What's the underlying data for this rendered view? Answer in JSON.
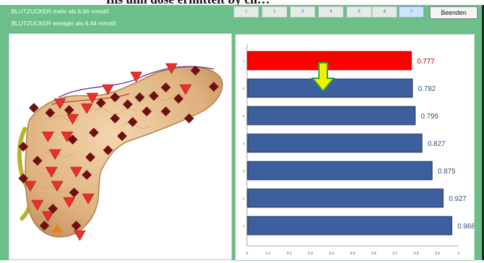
{
  "header": {
    "partial_title": "Ins ulin dose ermittelt by ch…",
    "line1": "BLUTZUCKER mehr als 6.66 mmol/l",
    "line2": "BLUTZUCKER weniger als 4.44 mmol/l"
  },
  "toolbar": {
    "dose_buttons": [
      "1",
      "2",
      "3",
      "4",
      "5",
      "6",
      "7"
    ],
    "active_index": 6,
    "end_label": "Beenden"
  },
  "image": {
    "subject": "pancreas illustration",
    "markers": {
      "triangle_color": "#e8312b",
      "diamond_color": "#6e1010",
      "accent_triangle_color": "#f07b20"
    }
  },
  "colors": {
    "bar": "#3e5f9e",
    "highlight": "#ff0000",
    "arrow": "#f5f000",
    "arrow_outline": "#22a83a"
  },
  "chart_data": {
    "type": "bar",
    "orientation": "horizontal",
    "categories": [
      "7",
      "6",
      "5",
      "4",
      "3",
      "2",
      "1"
    ],
    "values": [
      0.777,
      0.782,
      0.795,
      0.827,
      0.875,
      0.927,
      0.968
    ],
    "value_labels": [
      "0.777",
      "0.782",
      "0.795",
      "0.827",
      "0.875",
      "0.927",
      "0.968"
    ],
    "highlight_index": 0,
    "xlim": [
      0,
      1
    ],
    "x_ticks": [
      "0",
      "0.1",
      "0.2",
      "0.3",
      "0.4",
      "0.5",
      "0.6",
      "0.7",
      "0.8",
      "0.9",
      "1"
    ],
    "title": "",
    "xlabel": "",
    "ylabel": "",
    "grid": false,
    "legend": "none"
  }
}
